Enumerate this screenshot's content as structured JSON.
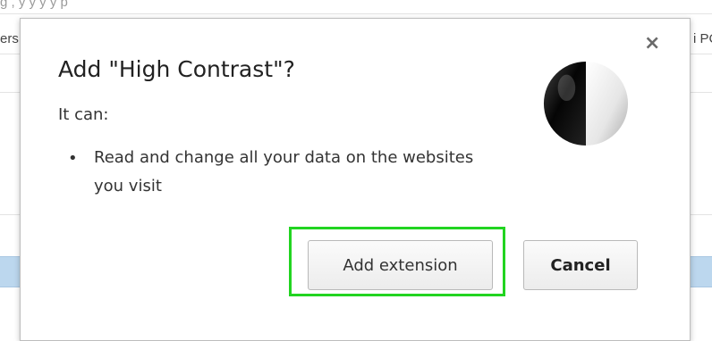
{
  "background": {
    "top_text": "g        ,  y              y   y  y        p",
    "left_text": "ers",
    "right_text": "i PC"
  },
  "dialog": {
    "title": "Add \"High Contrast\"?",
    "subtitle": "It can:",
    "permissions": [
      "Read and change all your data on the websites you visit"
    ],
    "close_label": "×",
    "buttons": {
      "add_label": "Add extension",
      "cancel_label": "Cancel"
    },
    "icon": "high-contrast-icon",
    "highlight_color": "#22d421"
  }
}
